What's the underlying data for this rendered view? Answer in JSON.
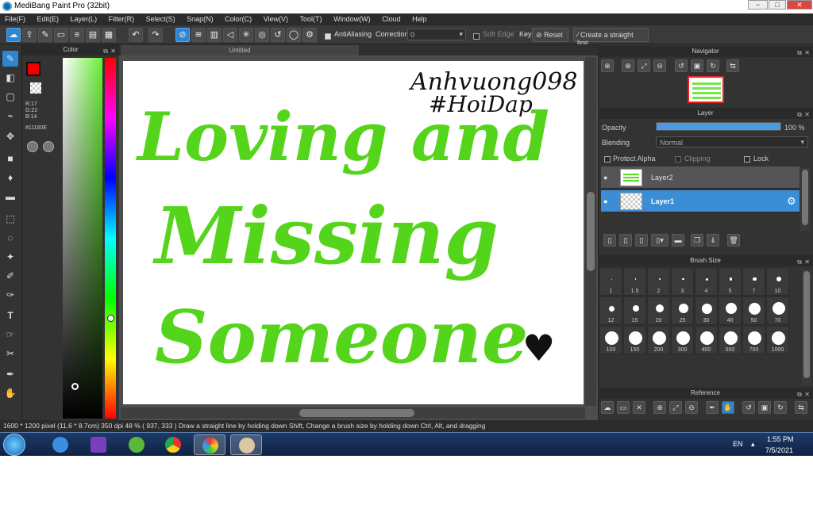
{
  "window": {
    "title": "MediBang Paint Pro (32bit)",
    "controls": [
      "−",
      "□",
      "✕"
    ]
  },
  "menu": [
    "File(F)",
    "Edit(E)",
    "Layer(L)",
    "Filter(R)",
    "Select(S)",
    "Snap(N)",
    "Color(C)",
    "View(V)",
    "Tool(T)",
    "Window(W)",
    "Cloud",
    "Help"
  ],
  "toolbar": {
    "antialiasing_label": "AntiAliasing",
    "correction_label": "Correction",
    "correction_value": "0",
    "soft_edge_label": "Soft Edge",
    "key_label": "Key",
    "reset_label": "Reset",
    "straight_line_label": "Create a straight line"
  },
  "color_panel": {
    "title": "Color",
    "r": "R:17",
    "g": "G:22",
    "b": "B:14",
    "hex": "#11160E",
    "fg_color": "#e00000",
    "gradient_color": "#66ee33"
  },
  "document": {
    "tab_title": "Untitled"
  },
  "canvas": {
    "signature_line1": "Anhvuong098",
    "signature_line2": "#HoiDap",
    "text_line1": "Loving and",
    "text_line2": "Missing",
    "text_line3": "Someone",
    "heart": "♥",
    "text_color": "#55d41c"
  },
  "navigator": {
    "title": "Navigator"
  },
  "layer_panel": {
    "title": "Layer",
    "opacity_label": "Opacity",
    "opacity_value": "100 %",
    "opacity_fraction": 1.0,
    "blending_label": "Blending",
    "blending_value": "Normal",
    "protect_alpha": "Protect Alpha",
    "clipping": "Clipping",
    "lock": "Lock",
    "layers": [
      {
        "name": "Layer2",
        "selected": false
      },
      {
        "name": "Layer1",
        "selected": true
      }
    ]
  },
  "brush_size": {
    "title": "Brush Size",
    "sizes": [
      "1",
      "1.5",
      "2",
      "3",
      "4",
      "5",
      "7",
      "10",
      "12",
      "15",
      "20",
      "25",
      "30",
      "40",
      "50",
      "70",
      "100",
      "150",
      "200",
      "300",
      "400",
      "500",
      "700",
      "1000"
    ]
  },
  "reference": {
    "title": "Reference"
  },
  "status": "1600 * 1200 pixel   (11.6 * 8.7cm)   350 dpi   48 %   ( 937, 333 )   Draw a straight line by holding down Shift, Change a brush size by holding down Ctrl, Alt, and dragging",
  "taskbar": {
    "lang": "EN",
    "time": "1:55 PM",
    "date": "7/5/2021"
  }
}
